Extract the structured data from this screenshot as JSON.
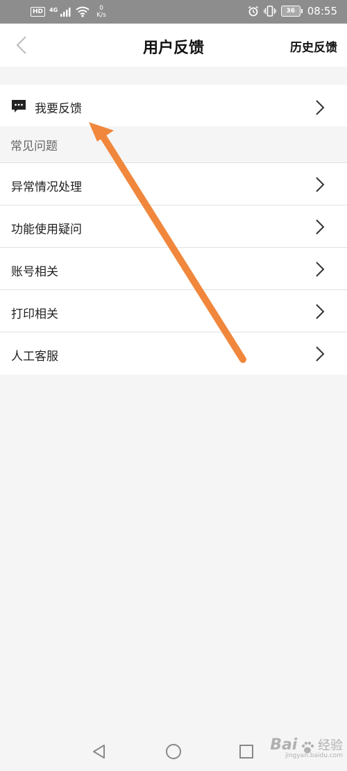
{
  "status_bar": {
    "hd": "HD",
    "network": "4G",
    "speed_value": "0",
    "speed_unit": "K/s",
    "battery": "36",
    "time": "08:55"
  },
  "header": {
    "title": "用户反馈",
    "history_label": "历史反馈"
  },
  "feedback": {
    "label": "我要反馈"
  },
  "faq": {
    "section_title": "常见问题",
    "items": [
      {
        "label": "异常情况处理"
      },
      {
        "label": "功能使用疑问"
      },
      {
        "label": "账号相关"
      },
      {
        "label": "打印相关"
      },
      {
        "label": "人工客服"
      }
    ]
  },
  "annotation": {
    "color": "#f0873c"
  },
  "watermark": {
    "brand": "Bai",
    "brand2": "经验",
    "url": "jingyan.baidu.com"
  },
  "colors": {
    "status_bar_bg": "#8d8d8d",
    "page_bg": "#f5f5f5",
    "row_bg": "#ffffff",
    "divider": "#e0e0e0"
  }
}
